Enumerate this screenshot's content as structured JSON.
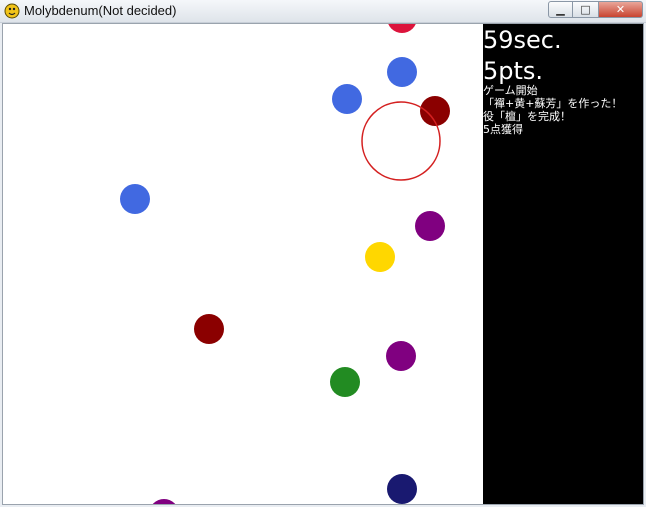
{
  "window": {
    "title": "Molybdenum(Not decided)",
    "app_icon": "python-snake-icon",
    "controls": [
      {
        "name": "minimize-button",
        "glyph": "▁"
      },
      {
        "name": "maximize-button",
        "glyph": "□"
      },
      {
        "name": "close-button",
        "glyph": "✕"
      }
    ]
  },
  "hud": {
    "timer": "59sec.",
    "score": "5pts.",
    "log": [
      "ゲーム開始",
      "「襌+黄+蘇芳」を作った！",
      "役「檀」を完成！",
      "5点獲得"
    ]
  },
  "colors": {
    "red": "#dc143c",
    "royalblue": "#4169e1",
    "darkred": "#8b0000",
    "purple": "#800080",
    "gold": "#ffd700",
    "green": "#228b22",
    "navy": "#191970",
    "cursor_ring": "#d42020",
    "panel_bg": "#000000"
  }
}
